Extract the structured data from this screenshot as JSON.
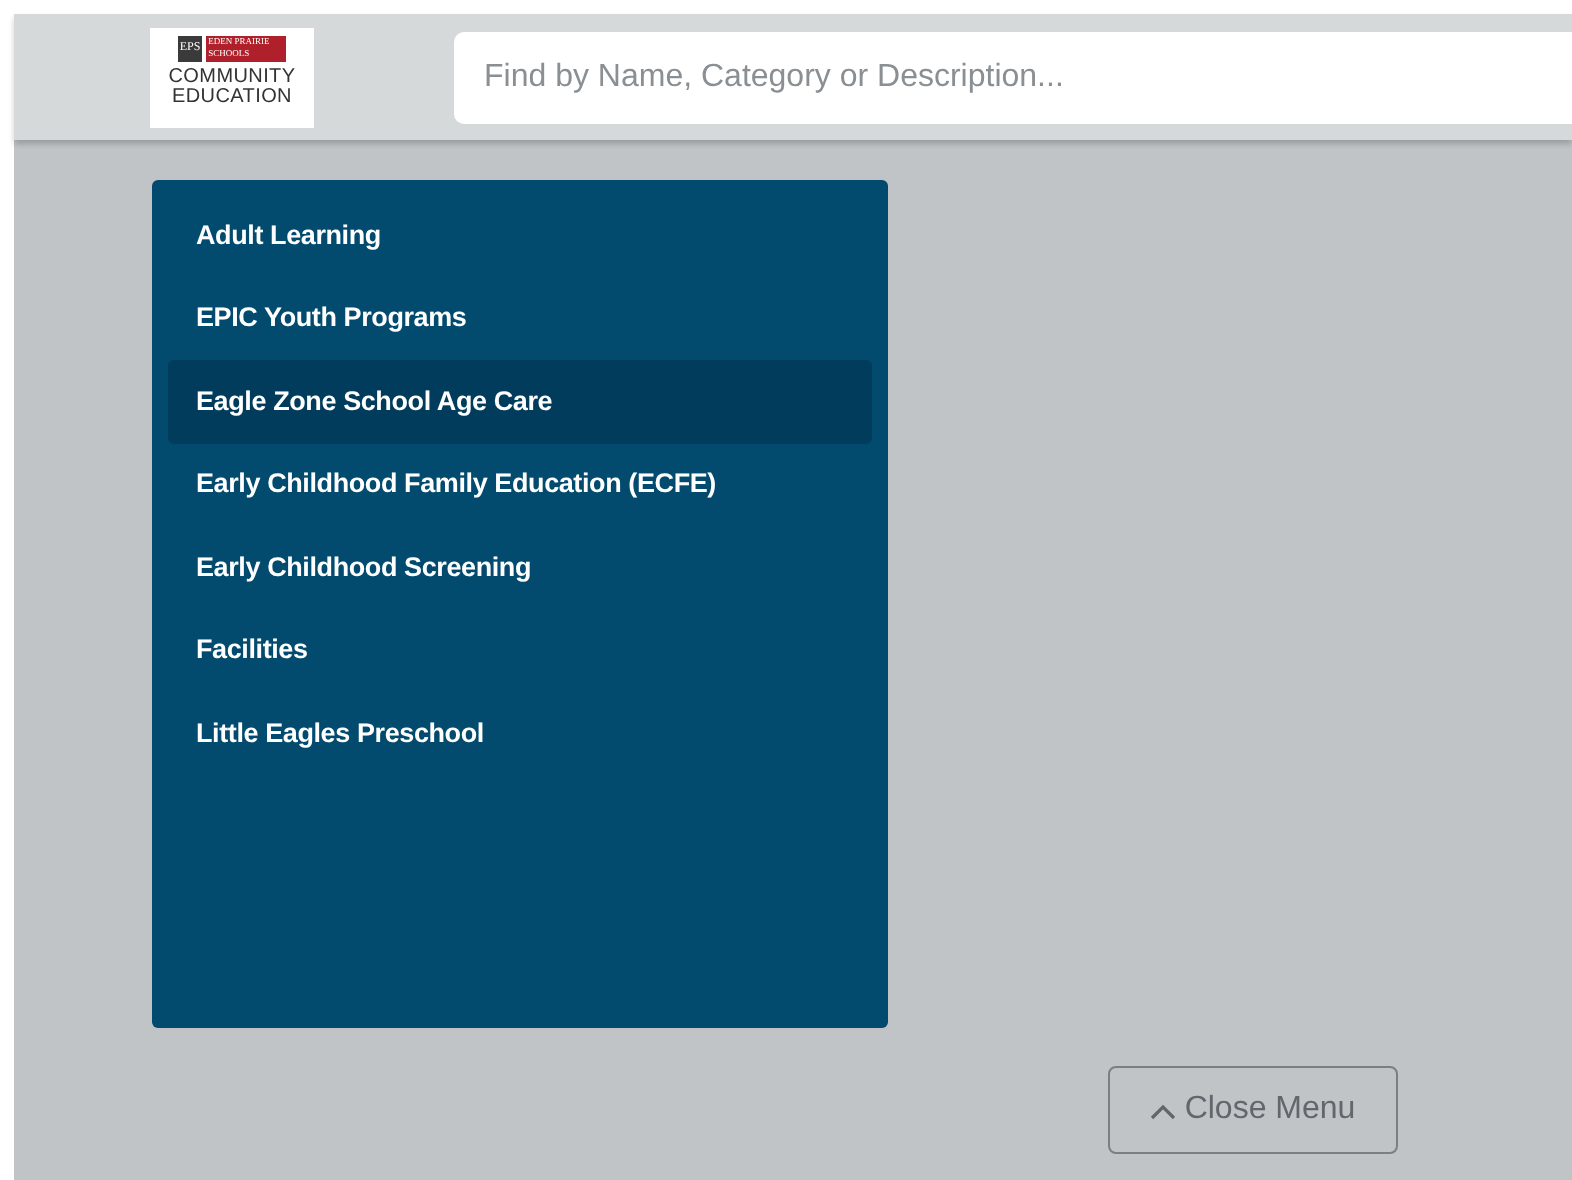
{
  "logo": {
    "badge": "EPS",
    "district": "EDEN PRAIRIE SCHOOLS",
    "line_1": "COMMUNITY",
    "line_2": "EDUCATION"
  },
  "search": {
    "placeholder": "Find by Name, Category or Description..."
  },
  "menu": [
    {
      "label": "Adult Learning",
      "selected": false
    },
    {
      "label": "EPIC Youth Programs",
      "selected": false
    },
    {
      "label": "Eagle Zone School Age Care",
      "selected": true
    },
    {
      "label": "Early Childhood Family Education (ECFE)",
      "selected": false
    },
    {
      "label": "Early Childhood Screening",
      "selected": false
    },
    {
      "label": "Facilities",
      "selected": false
    },
    {
      "label": "Little Eagles Preschool",
      "selected": false
    }
  ],
  "close_button": {
    "label": "Close Menu"
  }
}
